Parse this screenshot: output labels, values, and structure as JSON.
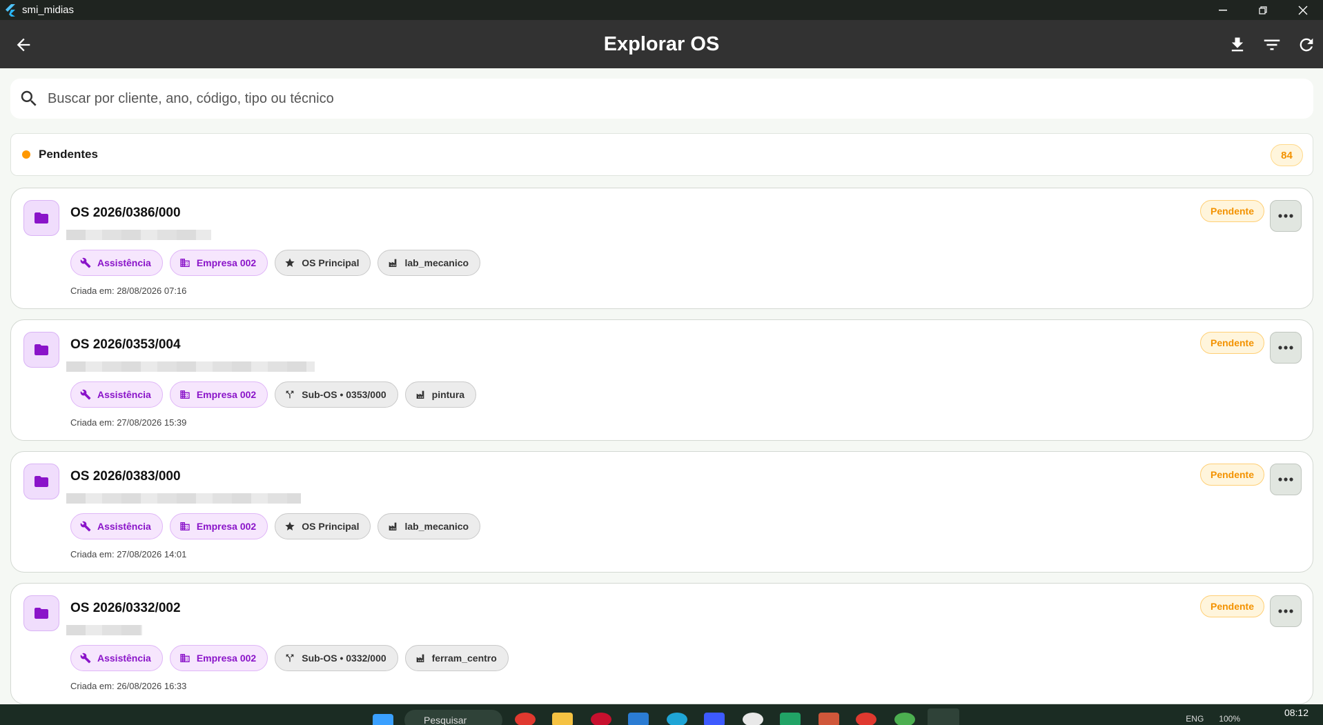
{
  "window": {
    "title": "smi_midias"
  },
  "appbar": {
    "title": "Explorar OS"
  },
  "search": {
    "placeholder": "Buscar por cliente, ano, código, tipo ou técnico"
  },
  "group": {
    "title": "Pendentes",
    "count": "84",
    "color": "#ff9800"
  },
  "cards": [
    {
      "code": "OS 2026/0386/000",
      "status": "Pendente",
      "chips": [
        "Assistência",
        "Empresa 002",
        "OS Principal",
        "lab_mecanico"
      ],
      "created": "Criada em: 28/08/2026 07:16"
    },
    {
      "code": "OS 2026/0353/004",
      "status": "Pendente",
      "chips": [
        "Assistência",
        "Empresa 002",
        "Sub-OS • 0353/000",
        "pintura"
      ],
      "created": "Criada em: 27/08/2026 15:39"
    },
    {
      "code": "OS 2026/0383/000",
      "status": "Pendente",
      "chips": [
        "Assistência",
        "Empresa 002",
        "OS Principal",
        "lab_mecanico"
      ],
      "created": "Criada em: 27/08/2026 14:01"
    },
    {
      "code": "OS 2026/0332/002",
      "status": "Pendente",
      "chips": [
        "Assistência",
        "Empresa 002",
        "Sub-OS • 0332/000",
        "ferram_centro"
      ],
      "created": "Criada em: 26/08/2026 16:33"
    }
  ],
  "taskbar": {
    "search_label": "Pesquisar",
    "lang": "ENG",
    "battery": "100%",
    "time": "08:12"
  },
  "colors": {
    "accent_purple": "#8a14c9",
    "status_orange": "#f39200",
    "appbar": "#323232"
  }
}
